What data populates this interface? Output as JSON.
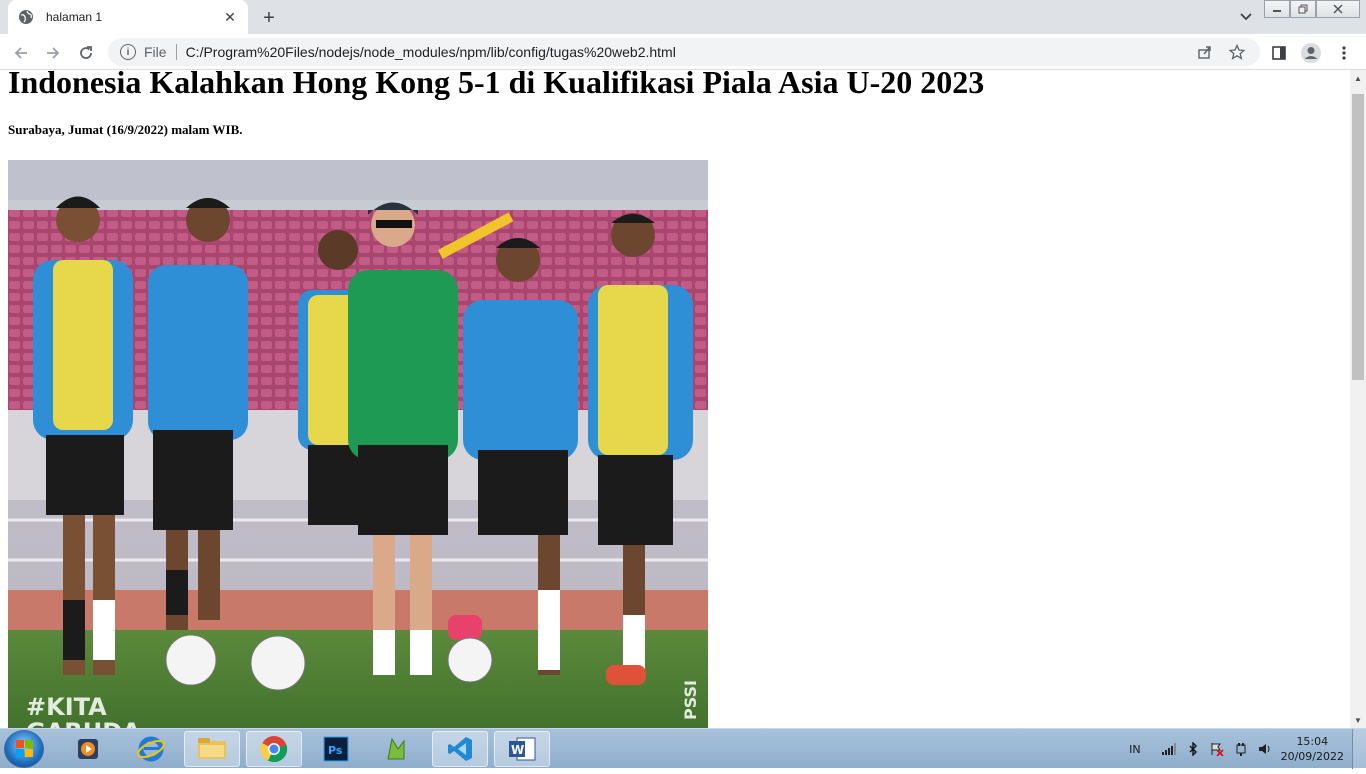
{
  "browser": {
    "tab_title": "halaman 1",
    "address_prefix": "File",
    "url": "C:/Program%20Files/nodejs/node_modules/npm/lib/config/tugas%20web2.html"
  },
  "article": {
    "headline": "Indonesia Kalahkan Hong Kong 5-1 di Kualifikasi Piala Asia U-20 2023",
    "dateline": "Surabaya, Jumat (16/9/2022) malam WIB.",
    "photo_caption_overlay": "#KITA GARUDA"
  },
  "taskbar": {
    "apps": [
      "media-player",
      "internet-explorer",
      "file-explorer",
      "chrome",
      "photoshop",
      "app-green",
      "vscode",
      "word"
    ],
    "language": "IN",
    "time": "15:04",
    "date": "20/09/2022"
  }
}
